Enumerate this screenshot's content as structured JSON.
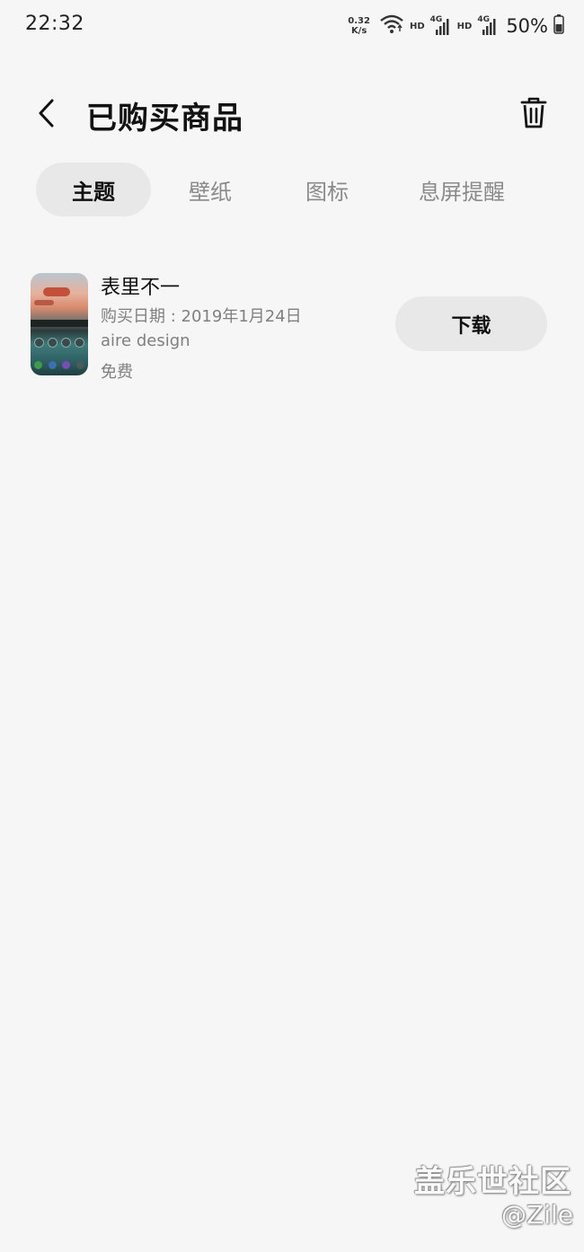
{
  "status_bar": {
    "time": "22:32",
    "net_speed_value": "0.32",
    "net_speed_unit": "K/s",
    "hd_1": "HD",
    "net_1": "4G",
    "hd_2": "HD",
    "net_2": "4G",
    "battery": "50%",
    "icons": [
      "wifi-icon",
      "signal-icon",
      "signal-icon",
      "battery-icon"
    ]
  },
  "header": {
    "title": "已购买商品",
    "back_icon": "chevron-left-icon",
    "delete_icon": "trash-icon"
  },
  "tabs": [
    {
      "label": "主题",
      "active": true
    },
    {
      "label": "壁纸",
      "active": false
    },
    {
      "label": "图标",
      "active": false
    },
    {
      "label": "息屏提醒",
      "active": false
    }
  ],
  "items": [
    {
      "name": "表里不一",
      "purchase_date": "购买日期 : 2019年1月24日",
      "author": "aire design",
      "price": "免费",
      "action_label": "下载"
    }
  ],
  "watermark": {
    "title": "盖乐世社区",
    "user": "@Zile"
  },
  "colors": {
    "background": "#f6f6f6",
    "pill": "#e8e8e8",
    "text_primary": "#111111",
    "text_secondary": "#808080",
    "tab_inactive": "#8a8a8a"
  }
}
